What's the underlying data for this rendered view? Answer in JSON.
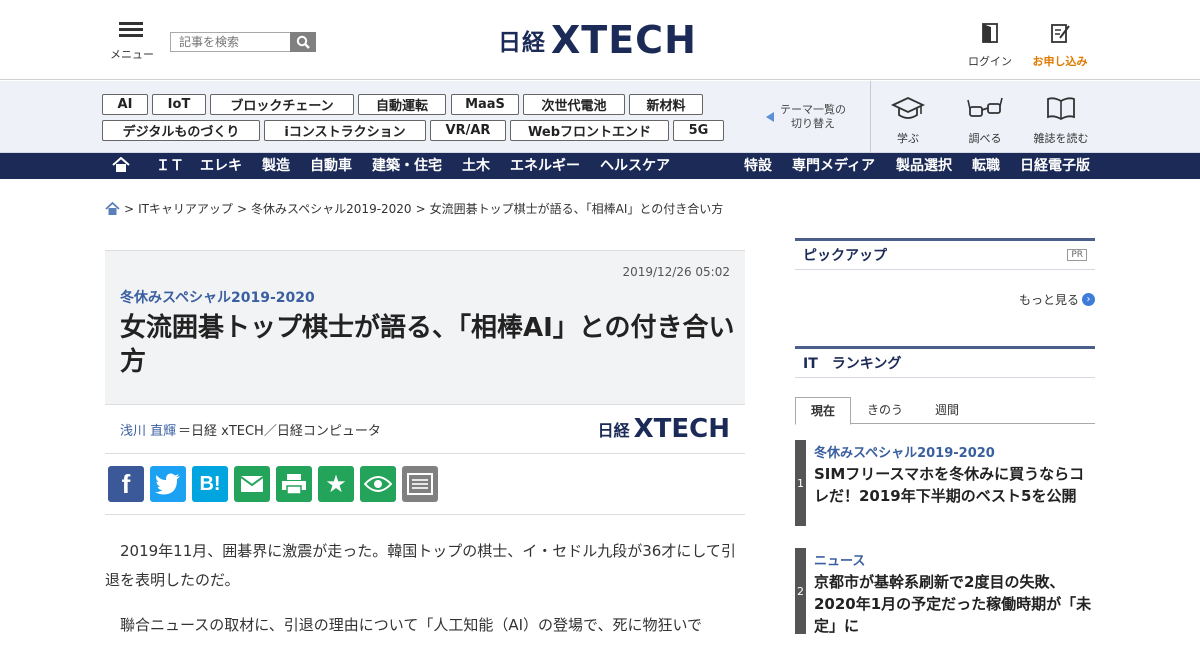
{
  "header": {
    "menu_label": "メニュー",
    "search_placeholder": "記事を検索",
    "logo_jp": "日経",
    "logo_x": "XTECH",
    "login_label": "ログイン",
    "apply_label": "お申し込み"
  },
  "tags": [
    "AI",
    "IoT",
    "ブロックチェーン",
    "自動運転",
    "MaaS",
    "次世代電池",
    "新材料",
    "デジタルものづくり",
    "iコンストラクション",
    "VR/AR",
    "Webフロントエンド",
    "5G"
  ],
  "theme_switch": {
    "line1": "テーマ一覧の",
    "line2": "切り替え"
  },
  "actions": [
    {
      "label": "学ぶ",
      "icon": "graduation-cap-icon"
    },
    {
      "label": "調べる",
      "icon": "glasses-icon"
    },
    {
      "label": "雑誌を読む",
      "icon": "book-icon"
    }
  ],
  "nav": {
    "left": [
      "ＩＴ",
      "エレキ",
      "製造",
      "自動車",
      "建築・住宅",
      "土木",
      "エネルギー",
      "ヘルスケア"
    ],
    "right": [
      "特設",
      "専門メディア",
      "製品選択",
      "転職",
      "日経電子版"
    ]
  },
  "breadcrumb": [
    ">",
    "ITキャリアアップ",
    ">",
    "冬休みスペシャル2019-2020",
    ">",
    "女流囲碁トップ棋士が語る、「相棒AI」との付き合い方"
  ],
  "article": {
    "date": "2019/12/26 05:02",
    "series": "冬休みスペシャル2019-2020",
    "title": "女流囲碁トップ棋士が語る、「相棒AI」との付き合い方",
    "author": "浅川 直輝",
    "org": "＝日経 xTECH／日経コンピュータ",
    "logo_jp": "日経",
    "logo_x": "XTECH",
    "share": [
      {
        "name": "facebook",
        "glyph": "f",
        "color": "#3b5998"
      },
      {
        "name": "twitter",
        "glyph": "🐦",
        "color": "#1da1f2"
      },
      {
        "name": "hatena",
        "glyph": "B!",
        "color": "#00a4de"
      },
      {
        "name": "mail",
        "glyph": "✉",
        "color": "#24a35a"
      },
      {
        "name": "print",
        "glyph": "⎙",
        "color": "#24a35a"
      },
      {
        "name": "bookmark",
        "glyph": "★",
        "color": "#24a35a"
      },
      {
        "name": "watch",
        "glyph": "◉",
        "color": "#24a35a"
      },
      {
        "name": "memo",
        "glyph": "▤",
        "color": "#808080"
      }
    ],
    "paragraphs": [
      "2019年11月、囲碁界に激震が走った。韓国トップの棋士、イ・セドル九段が36才にして引退を表明したのだ。",
      "聯合ニュースの取材に、引退の理由について「人工知能（AI）の登場で、死に物狂いで"
    ]
  },
  "sidebar": {
    "pickup_title": "ピックアップ",
    "pr": "PR",
    "more": "もっと見る",
    "ranking_title": "IT　ランキング",
    "tabs": [
      "現在",
      "きのう",
      "週間"
    ],
    "ranking": [
      {
        "num": "1",
        "category": "冬休みスペシャル2019-2020",
        "title": "SIMフリースマホを冬休みに買うならコレだ！2019年下半期のベスト5を公開"
      },
      {
        "num": "2",
        "category": "ニュース",
        "title": "京都市が基幹系刷新で2度目の失敗、2020年1月の予定だった稼働時期が「未定」に"
      }
    ]
  }
}
